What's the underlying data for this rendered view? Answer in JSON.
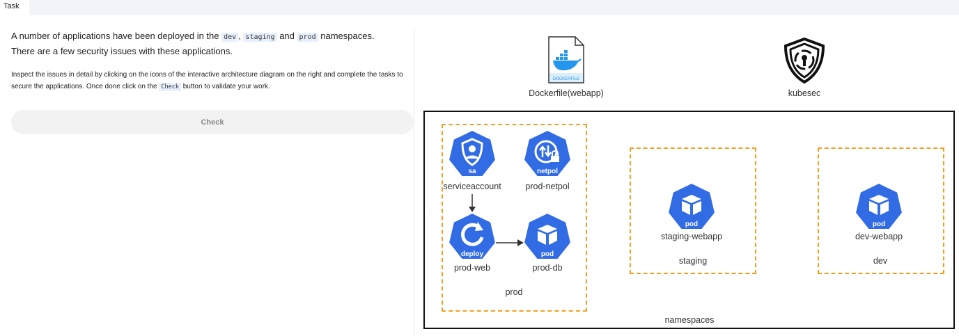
{
  "tab": {
    "label": "Task"
  },
  "intro": {
    "line1_before": "A number of applications have been deployed in the ",
    "dev": "dev",
    "comma": ",",
    "staging": "staging",
    "and": "and",
    "prod": "prod",
    "line1_after": " namespaces.",
    "line2": "There are a few security issues with these applications."
  },
  "detail": {
    "before": "Inspect the issues in detail by clicking on the icons of the interactive architecture diagram on the right and complete the tasks to secure the applications. Once done click on the ",
    "check_code": "Check",
    "after": " button to validate your work."
  },
  "check_button": {
    "label": "Check"
  },
  "diagram": {
    "dockerfile": {
      "label": "Dockerfile(webapp)",
      "badge": "DOCKERFILE"
    },
    "kubesec": {
      "label": "kubesec"
    },
    "namespaces_label": "namespaces",
    "prod": {
      "label": "prod",
      "serviceaccount": {
        "label": "serviceaccount",
        "tag": "sa"
      },
      "netpol": {
        "label": "prod-netpol",
        "tag": "netpol"
      },
      "deploy": {
        "label": "prod-web",
        "tag": "deploy"
      },
      "pod": {
        "label": "prod-db",
        "tag": "pod"
      }
    },
    "staging": {
      "label": "staging",
      "pod": {
        "label": "staging-webapp",
        "tag": "pod"
      }
    },
    "dev": {
      "label": "dev",
      "pod": {
        "label": "dev-webapp",
        "tag": "pod"
      }
    }
  },
  "colors": {
    "k8s_blue": "#326ce5",
    "dash_orange": "#f0a020",
    "docker_blue": "#2496ed",
    "code_bg": "#e8f0fd"
  }
}
